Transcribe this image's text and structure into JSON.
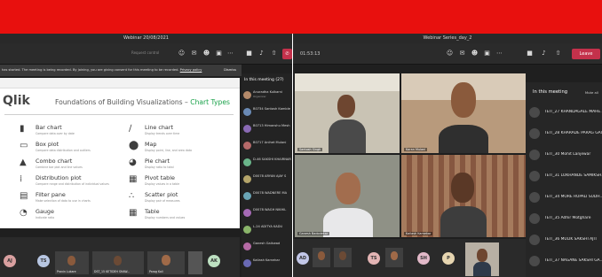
{
  "colors": {
    "band": "#e8100e",
    "leave": "#c4314b",
    "qlik_green": "#1aa24a"
  },
  "left_window": {
    "title": "Webinar 20/08/2021",
    "meeting_placeholder": "Request control",
    "banner": {
      "text": "has started.  The meeting is being recorded. By joining, you are giving consent for this meeting to be recorded.",
      "link": "Privacy policy",
      "dismiss": "Dismiss"
    },
    "slide": {
      "logo": "Qlik",
      "logo_mark": "Q",
      "title": "Foundations of Building Visualizations – ",
      "title_accent": "Chart Types",
      "items_left": [
        {
          "name": "Bar chart",
          "desc": "Compare data over by date",
          "icon": "bar-chart-icon"
        },
        {
          "name": "Box plot",
          "desc": "Compare data distribution and outliers",
          "icon": "box-plot-icon"
        },
        {
          "name": "Combo chart",
          "desc": "Combine bar plot and line values",
          "icon": "combo-chart-icon"
        },
        {
          "name": "Distribution plot",
          "desc": "Compare range and distribution of individual values",
          "icon": "distribution-plot-icon"
        },
        {
          "name": "Filter pane",
          "desc": "Make selection of data to use in charts",
          "icon": "filter-pane-icon"
        },
        {
          "name": "Gauge",
          "desc": "Indicate ratio",
          "icon": "gauge-icon"
        }
      ],
      "items_right": [
        {
          "name": "Line chart",
          "desc": "Display trends over time",
          "icon": "line-chart-icon"
        },
        {
          "name": "Map",
          "desc": "Display point, line, and area data",
          "icon": "map-icon"
        },
        {
          "name": "Pie chart",
          "desc": "Display ratio to total",
          "icon": "pie-chart-icon"
        },
        {
          "name": "Pivot table",
          "desc": "Display values in a table",
          "icon": "pivot-table-icon"
        },
        {
          "name": "Scatter plot",
          "desc": "Display pair of measures",
          "icon": "scatter-plot-icon"
        },
        {
          "name": "Table",
          "desc": "Display numbers and values",
          "icon": "table-icon"
        }
      ]
    },
    "participants_header": "In this meeting (27)",
    "participants": [
      {
        "name": "Anuradha Kulkarni",
        "sub": "Organizer"
      },
      {
        "name": "B0734 Santosh Kamble",
        "sub": ""
      },
      {
        "name": "B0713 Himanshu Mesh",
        "sub": ""
      },
      {
        "name": "B0717 Anihet Mulani",
        "sub": ""
      },
      {
        "name": "D-46 SAKSHI KHAIRNAR",
        "sub": ""
      },
      {
        "name": "D0078 ARYAN AJAY S",
        "sub": ""
      },
      {
        "name": "D0078 WADNERE MA",
        "sub": ""
      },
      {
        "name": "D0078 WAGH NIKHIL",
        "sub": ""
      },
      {
        "name": "L-24 ADITYA KADU",
        "sub": ""
      },
      {
        "name": "Ganesh Gaikwad",
        "sub": ""
      },
      {
        "name": "Kailash Karnekar",
        "sub": ""
      }
    ],
    "strip": [
      {
        "initials": "AJ",
        "color": "#d9a0a0"
      },
      {
        "initials": "TS",
        "color": "#b7c6e2"
      },
      {
        "label": "Pravin Lukare"
      },
      {
        "label": "DST_15 KETIDEH SHAW..."
      },
      {
        "label": "Parag Koli"
      },
      {
        "initials": "AK",
        "color": "#bde0c1"
      }
    ]
  },
  "right_window": {
    "title": "Webinar Series_day_2",
    "timer": "01:53:13",
    "leave_label": "Leave",
    "tiles": [
      {
        "name": "Santosh Singh"
      },
      {
        "name": "Karan Mulani"
      },
      {
        "name": "Ganesh Badodekar"
      },
      {
        "name": "Kailash Karnekar"
      }
    ],
    "panel_header": "In this meeting",
    "mute_all": "Mute all",
    "participants": [
      "TEIT_27 KHANDAGALE MAHE...",
      "TEIT_28 KHARADE PARAG GAU...",
      "TEIT_30 Mohit Lanjewar",
      "TEIT_31 LOKHANDE SAMIKSH...",
      "TEIT_34 MORE RUPALI SUDH...",
      "TEIT_35 Adhir Motghare",
      "TEIT_36 MULIK SAKSHI AJIT",
      "TEIT_37 NAGANE SAKSHI GA..."
    ],
    "strip": [
      {
        "initials": "AD",
        "color": "#c2c7e8"
      },
      {
        "initials": "TS",
        "color": "#e3b4b4"
      },
      {
        "initials": "SH",
        "color": "#e2b9c9"
      },
      {
        "initials": "P",
        "color": "#e6d5b0"
      }
    ]
  }
}
